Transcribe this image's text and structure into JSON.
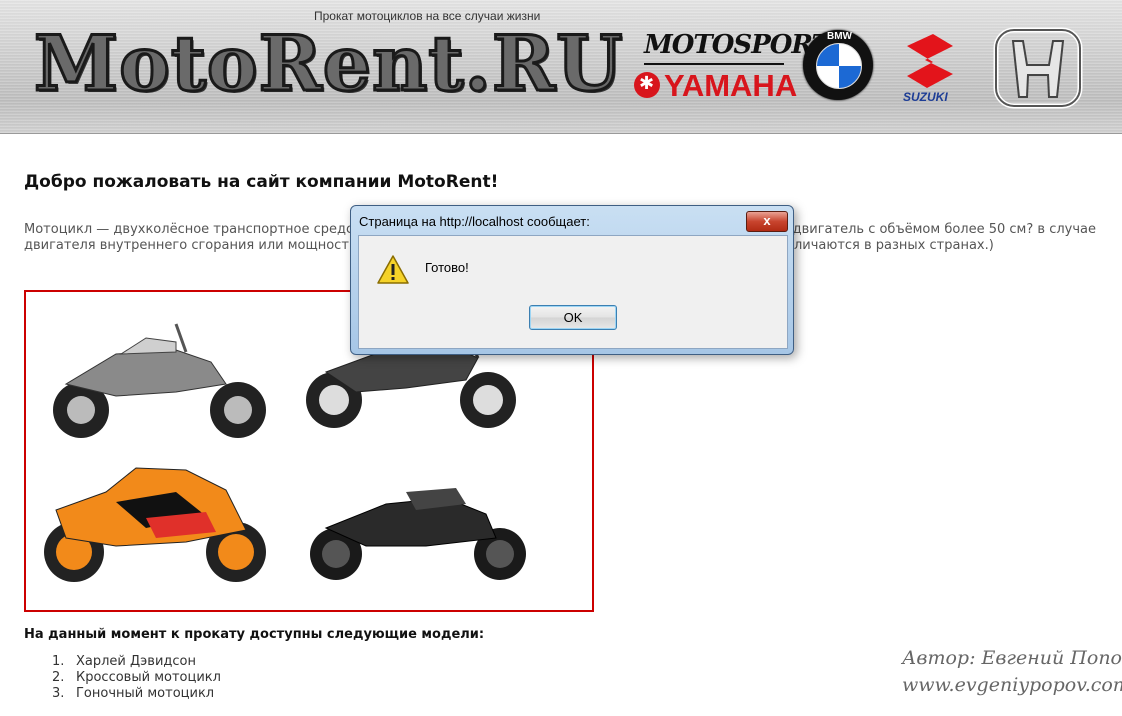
{
  "header": {
    "slogan": "Прокат мотоциклов на все случаи жизни",
    "logo": "MotoRent.RU",
    "brands": [
      "MOTOSPORT",
      "YAMAHA",
      "BMW",
      "SUZUKI",
      "HONDA"
    ],
    "colors": {
      "yamaha_red": "#d8151c",
      "suzuki_red": "#e3141b",
      "bmw_blue": "#1c69d4"
    }
  },
  "main": {
    "title": "Добро пожаловать на сайт компании MotoRent!",
    "intro": "Мотоцикл — двухколёсное транспортное средство с механическим двигателем, массой не более 400 кг и/или двигатель с объёмом более 50 см? в случае двигателя внутреннего сгорания или мощностью более 4 кВт в случае электродвигателя. Впрочем, нормы различаются в разных странах.)",
    "frame_color": "#cc0000",
    "models_title": "На данный момент к прокату доступны следующие модели:",
    "models": [
      {
        "num": "1.",
        "name": "Харлей Дэвидсон"
      },
      {
        "num": "2.",
        "name": "Кроссовый мотоцикл"
      },
      {
        "num": "3.",
        "name": "Гоночный мотоцикл"
      }
    ],
    "author": "Автор: Евгений Попов",
    "author_site": "www.evgeniypopov.com"
  },
  "dialog": {
    "title": "Страница на http://localhost сообщает:",
    "close_label": "x",
    "message": "Готово!",
    "ok_label": "OK",
    "icon": "warning-icon"
  }
}
